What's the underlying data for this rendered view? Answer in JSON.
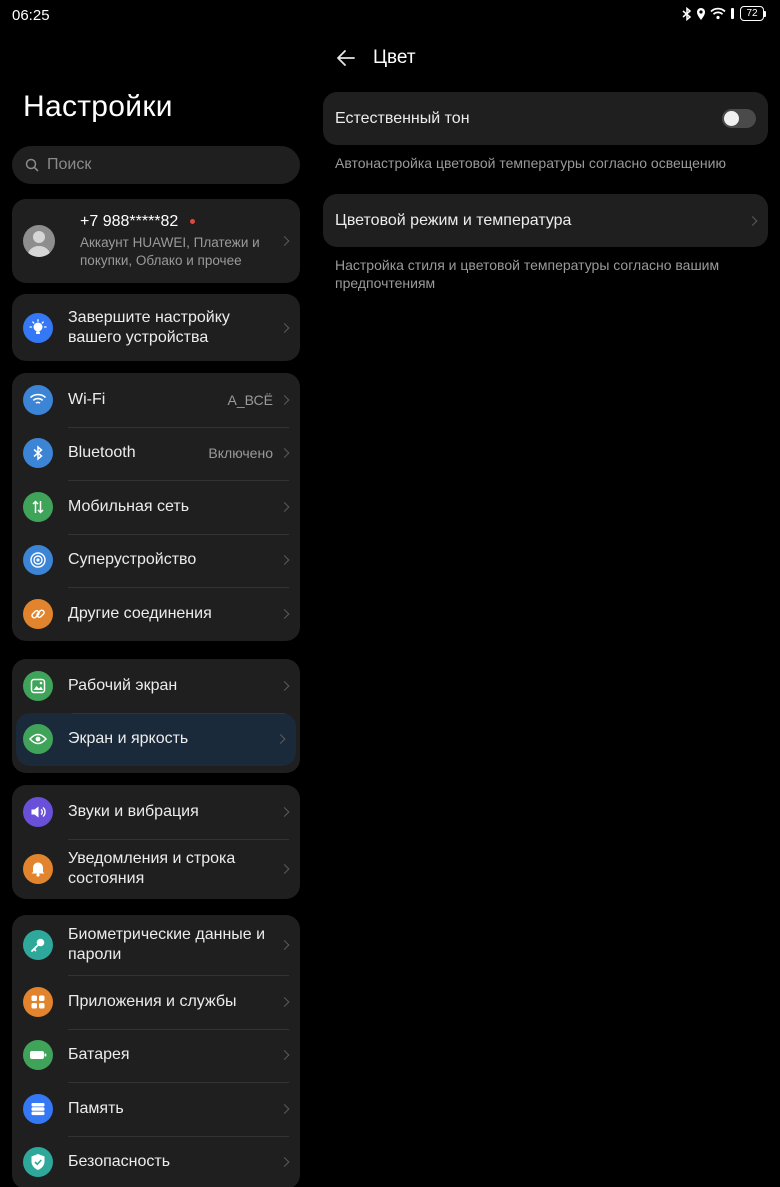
{
  "status": {
    "time": "06:25",
    "battery": "72"
  },
  "left": {
    "title": "Настройки",
    "search_placeholder": "Поиск",
    "account": {
      "phone": "+7 988*****82",
      "subtitle": "Аккаунт HUAWEI, Платежи и покупки, Облако и прочее"
    },
    "setup": {
      "label": "Завершите настройку вашего устройства",
      "icon": "lightbulb-icon",
      "color": "#3478f6"
    },
    "connectivity": [
      {
        "label": "Wi-Fi",
        "value": "A_ВСЁ",
        "icon": "wifi-icon",
        "color": "#3b84d6"
      },
      {
        "label": "Bluetooth",
        "value": "Включено",
        "icon": "bluetooth-icon",
        "color": "#3b84d6"
      },
      {
        "label": "Мобильная сеть",
        "value": "",
        "icon": "mobile-network-icon",
        "color": "#3fa45a"
      },
      {
        "label": "Суперустройство",
        "value": "",
        "icon": "superdevice-icon",
        "color": "#3b84d6"
      },
      {
        "label": "Другие соединения",
        "value": "",
        "icon": "link-icon",
        "color": "#e2842d"
      }
    ],
    "display": [
      {
        "label": "Рабочий экран",
        "icon": "home-screen-icon",
        "color": "#3fa45a"
      },
      {
        "label": "Экран и яркость",
        "icon": "eye-icon",
        "color": "#3fa45a"
      }
    ],
    "sound": [
      {
        "label": "Звуки и вибрация",
        "icon": "speaker-icon",
        "color": "#6a4fd8"
      },
      {
        "label": "Уведомления и строка состояния",
        "icon": "bell-icon",
        "color": "#e2842d"
      }
    ],
    "system": [
      {
        "label": "Биометрические данные и пароли",
        "icon": "key-icon",
        "color": "#2ea89a"
      },
      {
        "label": "Приложения и службы",
        "icon": "apps-icon",
        "color": "#e2842d"
      },
      {
        "label": "Батарея",
        "icon": "battery-icon",
        "color": "#3fa45a"
      },
      {
        "label": "Память",
        "icon": "storage-icon",
        "color": "#3478f6"
      },
      {
        "label": "Безопасность",
        "icon": "shield-icon",
        "color": "#2ea89a"
      }
    ]
  },
  "right": {
    "title": "Цвет",
    "natural_tone": {
      "label": "Естественный тон",
      "enabled": false,
      "hint": "Автонастройка цветовой температуры согласно освещению"
    },
    "color_mode": {
      "label": "Цветовой режим и температура",
      "hint": "Настройка стиля и цветовой температуры согласно вашим предпочтениям"
    }
  }
}
